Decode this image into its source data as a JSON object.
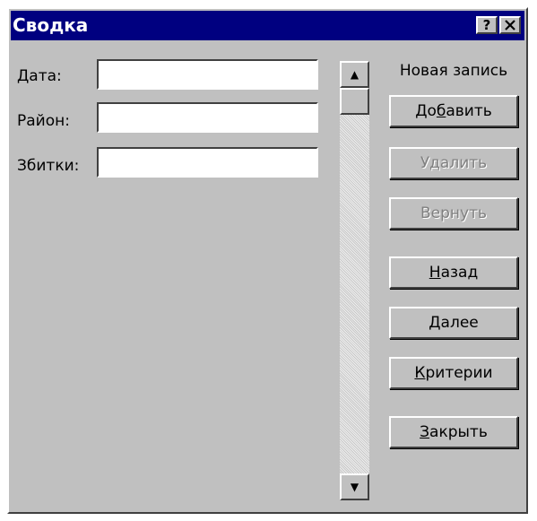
{
  "window": {
    "title": "Сводка",
    "help_button": "?",
    "close_button": "✕"
  },
  "fields": [
    {
      "label": "Дата:",
      "value": ""
    },
    {
      "label": "Район:",
      "value": ""
    },
    {
      "label": "Збитки:",
      "value": ""
    }
  ],
  "scrollbar": {
    "up_icon": "▲",
    "down_icon": "▼"
  },
  "record_status": "Новая запись",
  "buttons": {
    "add": {
      "pre": "До",
      "mnemonic": "б",
      "post": "авить"
    },
    "delete": {
      "label": "Удалить",
      "disabled": true
    },
    "restore": {
      "label": "Вернуть",
      "disabled": true
    },
    "back": {
      "pre": "",
      "mnemonic": "Н",
      "post": "азад"
    },
    "next": {
      "pre": "",
      "mnemonic": "Д",
      "post": "алее"
    },
    "criteria": {
      "pre": "",
      "mnemonic": "К",
      "post": "ритерии"
    },
    "close": {
      "pre": "",
      "mnemonic": "З",
      "post": "акрыть"
    }
  }
}
